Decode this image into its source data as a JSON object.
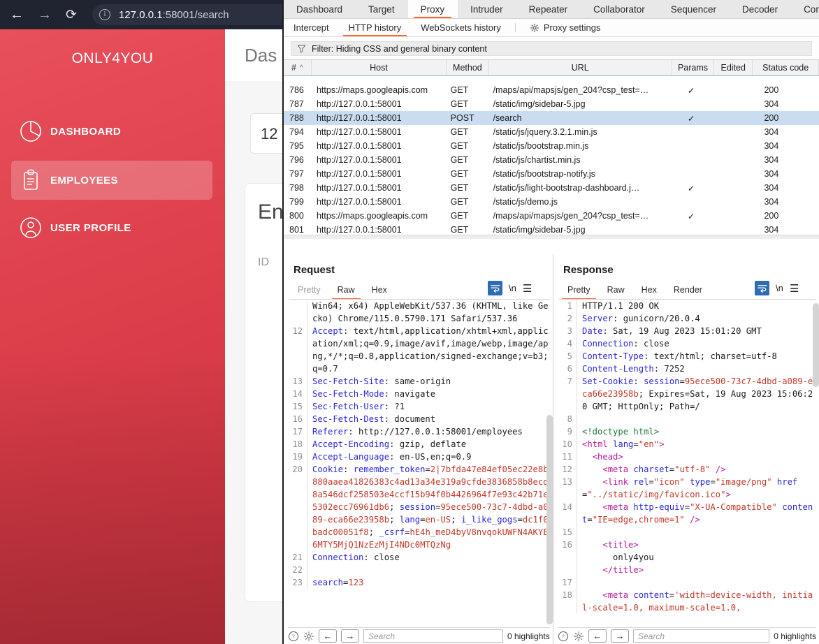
{
  "browser": {
    "url_host": "127.0.0.1",
    "url_rest": ":58001/search",
    "back_icon": "←",
    "forward_icon": "→",
    "reload_icon": "⟳",
    "info_icon": "i"
  },
  "webapp": {
    "brand": "ONLY4YOU",
    "nav": [
      {
        "label": "DASHBOARD",
        "icon": "pie-chart-icon"
      },
      {
        "label": "EMPLOYEES",
        "icon": "clipboard-icon"
      },
      {
        "label": "USER PROFILE",
        "icon": "user-circle-icon"
      }
    ],
    "page_title": "Das",
    "search_value": "12",
    "employees_card_title": "En",
    "employees_col_id": "ID"
  },
  "burp": {
    "main_tabs": [
      {
        "label": "Dashboard",
        "active": false
      },
      {
        "label": "Target",
        "active": false
      },
      {
        "label": "Proxy",
        "active": true
      },
      {
        "label": "Intruder",
        "active": false
      },
      {
        "label": "Repeater",
        "active": false
      },
      {
        "label": "Collaborator",
        "active": false
      },
      {
        "label": "Sequencer",
        "active": false
      },
      {
        "label": "Decoder",
        "active": false
      },
      {
        "label": "Comparer",
        "active": false
      }
    ],
    "sub_tabs": [
      {
        "label": "Intercept",
        "active": false
      },
      {
        "label": "HTTP history",
        "active": true
      },
      {
        "label": "WebSockets history",
        "active": false
      }
    ],
    "proxy_settings_label": "Proxy settings",
    "filter_text": "Filter: Hiding CSS and general binary content",
    "history": {
      "columns": [
        "#",
        "Host",
        "Method",
        "URL",
        "Params",
        "Edited",
        "Status code"
      ],
      "sort_indicator": "^",
      "rows": [
        {
          "num": "786",
          "host": "https://maps.googleapis.com",
          "method": "GET",
          "url": "/maps/api/mapsjs/gen_204?csp_test=…",
          "params": "✓",
          "edited": "",
          "status": "200",
          "selected": false
        },
        {
          "num": "787",
          "host": "http://127.0.0.1:58001",
          "method": "GET",
          "url": "/static/img/sidebar-5.jpg",
          "params": "",
          "edited": "",
          "status": "304",
          "selected": false
        },
        {
          "num": "788",
          "host": "http://127.0.0.1:58001",
          "method": "POST",
          "url": "/search",
          "params": "✓",
          "edited": "",
          "status": "200",
          "selected": true
        },
        {
          "num": "794",
          "host": "http://127.0.0.1:58001",
          "method": "GET",
          "url": "/static/js/jquery.3.2.1.min.js",
          "params": "",
          "edited": "",
          "status": "304",
          "selected": false
        },
        {
          "num": "795",
          "host": "http://127.0.0.1:58001",
          "method": "GET",
          "url": "/static/js/bootstrap.min.js",
          "params": "",
          "edited": "",
          "status": "304",
          "selected": false
        },
        {
          "num": "796",
          "host": "http://127.0.0.1:58001",
          "method": "GET",
          "url": "/static/js/chartist.min.js",
          "params": "",
          "edited": "",
          "status": "304",
          "selected": false
        },
        {
          "num": "797",
          "host": "http://127.0.0.1:58001",
          "method": "GET",
          "url": "/static/js/bootstrap-notify.js",
          "params": "",
          "edited": "",
          "status": "304",
          "selected": false
        },
        {
          "num": "798",
          "host": "http://127.0.0.1:58001",
          "method": "GET",
          "url": "/static/js/light-bootstrap-dashboard.j…",
          "params": "✓",
          "edited": "",
          "status": "304",
          "selected": false
        },
        {
          "num": "799",
          "host": "http://127.0.0.1:58001",
          "method": "GET",
          "url": "/static/js/demo.js",
          "params": "",
          "edited": "",
          "status": "304",
          "selected": false
        },
        {
          "num": "800",
          "host": "https://maps.googleapis.com",
          "method": "GET",
          "url": "/maps/api/mapsjs/gen_204?csp_test=…",
          "params": "✓",
          "edited": "",
          "status": "200",
          "selected": false
        },
        {
          "num": "801",
          "host": "http://127.0.0.1:58001",
          "method": "GET",
          "url": "/static/img/sidebar-5.jpg",
          "params": "",
          "edited": "",
          "status": "304",
          "selected": false
        }
      ]
    },
    "layout_buttons": [
      "side-by-side",
      "stacked",
      "single"
    ],
    "layout_selected": "side-by-side",
    "request": {
      "title": "Request",
      "tabs": [
        {
          "label": "Pretty",
          "active": false,
          "dim": true
        },
        {
          "label": "Raw",
          "active": true,
          "dim": false
        },
        {
          "label": "Hex",
          "active": false,
          "dim": false
        }
      ],
      "tool_newline": "\\n",
      "lines": [
        {
          "n": "",
          "parts": [
            {
              "t": "Win64; x64) AppleWebKit/537.36 (KHTML, like Gecko) Chrome/115.0.5790.171 Safari/537.36",
              "c": "plain"
            }
          ]
        },
        {
          "n": "12",
          "parts": [
            {
              "t": "Accept",
              "c": "hk"
            },
            {
              "t": ": ",
              "c": "plain"
            },
            {
              "t": "text/html,application/xhtml+xml,application/xml;q=0.9,image/avif,image/webp,image/apng,*/*;q=0.8,application/signed-exchange;v=b3;q=0.7",
              "c": "plain"
            }
          ]
        },
        {
          "n": "13",
          "parts": [
            {
              "t": "Sec-Fetch-Site",
              "c": "hk"
            },
            {
              "t": ": same-origin",
              "c": "plain"
            }
          ]
        },
        {
          "n": "14",
          "parts": [
            {
              "t": "Sec-Fetch-Mode",
              "c": "hk"
            },
            {
              "t": ": navigate",
              "c": "plain"
            }
          ]
        },
        {
          "n": "15",
          "parts": [
            {
              "t": "Sec-Fetch-User",
              "c": "hk"
            },
            {
              "t": ": ?1",
              "c": "plain"
            }
          ]
        },
        {
          "n": "16",
          "parts": [
            {
              "t": "Sec-Fetch-Dest",
              "c": "hk"
            },
            {
              "t": ": document",
              "c": "plain"
            }
          ]
        },
        {
          "n": "17",
          "parts": [
            {
              "t": "Referer",
              "c": "hk"
            },
            {
              "t": ": http://127.0.0.1:58001/employees",
              "c": "plain"
            }
          ]
        },
        {
          "n": "18",
          "parts": [
            {
              "t": "Accept-Encoding",
              "c": "hk"
            },
            {
              "t": ": gzip, deflate",
              "c": "plain"
            }
          ]
        },
        {
          "n": "19",
          "parts": [
            {
              "t": "Accept-Language",
              "c": "hk"
            },
            {
              "t": ": en-US,en;q=0.9",
              "c": "plain"
            }
          ]
        },
        {
          "n": "20",
          "parts": [
            {
              "t": "Cookie",
              "c": "hk"
            },
            {
              "t": ": ",
              "c": "plain"
            },
            {
              "t": "remember_token",
              "c": "hk"
            },
            {
              "t": "=",
              "c": "plain"
            },
            {
              "t": "2|7bfda47e84ef05ec22e8b880aaea41826383c4ad13a34e319a9cfde3836858b8ecd8a546dcf258503e4ccf15b94f0b4426964f7e93c42b71e5302ecc76961db6",
              "c": "red"
            },
            {
              "t": "; ",
              "c": "plain"
            },
            {
              "t": "session",
              "c": "hk"
            },
            {
              "t": "=",
              "c": "plain"
            },
            {
              "t": "95ece500-73c7-4dbd-a089-eca66e23958b",
              "c": "red"
            },
            {
              "t": "; ",
              "c": "plain"
            },
            {
              "t": "lang",
              "c": "hk"
            },
            {
              "t": "=",
              "c": "plain"
            },
            {
              "t": "en-US",
              "c": "red"
            },
            {
              "t": "; ",
              "c": "plain"
            },
            {
              "t": "i_like_gogs",
              "c": "hk"
            },
            {
              "t": "=",
              "c": "plain"
            },
            {
              "t": "dc1f0badc00051f8",
              "c": "red"
            },
            {
              "t": "; ",
              "c": "plain"
            },
            {
              "t": "_csrf",
              "c": "hk"
            },
            {
              "t": "=",
              "c": "plain"
            },
            {
              "t": "hE4h_meD4byV8nvqokUWFN4AKYE6MTY5MjQ1NzEzMjI4NDc0MTQzNg",
              "c": "red"
            }
          ]
        },
        {
          "n": "21",
          "parts": [
            {
              "t": "Connection",
              "c": "hk"
            },
            {
              "t": ": close",
              "c": "plain"
            }
          ]
        },
        {
          "n": "22",
          "parts": [
            {
              "t": "",
              "c": "plain"
            }
          ]
        },
        {
          "n": "23",
          "parts": [
            {
              "t": "search",
              "c": "hk"
            },
            {
              "t": "=",
              "c": "plain"
            },
            {
              "t": "123",
              "c": "red"
            }
          ]
        }
      ],
      "footer": {
        "help_icon": "?",
        "gear_icon": "gear-icon",
        "back_icon": "←",
        "forward_icon": "→",
        "search_placeholder": "Search",
        "highlights": "0 highlights"
      }
    },
    "response": {
      "title": "Response",
      "tabs": [
        {
          "label": "Pretty",
          "active": true,
          "dim": false
        },
        {
          "label": "Raw",
          "active": false,
          "dim": false
        },
        {
          "label": "Hex",
          "active": false,
          "dim": false
        },
        {
          "label": "Render",
          "active": false,
          "dim": false
        }
      ],
      "tool_newline": "\\n",
      "lines": [
        {
          "n": "1",
          "parts": [
            {
              "t": "HTTP/1.1 200 OK",
              "c": "plain"
            }
          ]
        },
        {
          "n": "2",
          "parts": [
            {
              "t": "Server",
              "c": "hk"
            },
            {
              "t": ": gunicorn/20.0.4",
              "c": "plain"
            }
          ]
        },
        {
          "n": "3",
          "parts": [
            {
              "t": "Date",
              "c": "hk"
            },
            {
              "t": ": Sat, 19 Aug 2023 15:01:20 GMT",
              "c": "plain"
            }
          ]
        },
        {
          "n": "4",
          "parts": [
            {
              "t": "Connection",
              "c": "hk"
            },
            {
              "t": ": close",
              "c": "plain"
            }
          ]
        },
        {
          "n": "5",
          "parts": [
            {
              "t": "Content-Type",
              "c": "hk"
            },
            {
              "t": ": text/html; charset=utf-8",
              "c": "plain"
            }
          ]
        },
        {
          "n": "6",
          "parts": [
            {
              "t": "Content-Length",
              "c": "hk"
            },
            {
              "t": ": 7252",
              "c": "plain"
            }
          ]
        },
        {
          "n": "7",
          "parts": [
            {
              "t": "Set-Cookie",
              "c": "hk"
            },
            {
              "t": ": ",
              "c": "plain"
            },
            {
              "t": "session",
              "c": "hk"
            },
            {
              "t": "=",
              "c": "plain"
            },
            {
              "t": "95ece500-73c7-4dbd-a089-eca66e23958b",
              "c": "red"
            },
            {
              "t": "; Expires=Sat, 19 Aug 2023 15:06:20 GMT; HttpOnly; Path=/",
              "c": "plain"
            }
          ]
        },
        {
          "n": "8",
          "parts": [
            {
              "t": "",
              "c": "plain"
            }
          ]
        },
        {
          "n": "9",
          "parts": [
            {
              "t": "<!doctype html>",
              "c": "doct"
            }
          ]
        },
        {
          "n": "10",
          "parts": [
            {
              "t": "<html ",
              "c": "tag"
            },
            {
              "t": "lang",
              "c": "attr"
            },
            {
              "t": "=",
              "c": "plain"
            },
            {
              "t": "\"en\"",
              "c": "str"
            },
            {
              "t": ">",
              "c": "tag"
            }
          ]
        },
        {
          "n": "11",
          "parts": [
            {
              "t": "  ",
              "c": "plain"
            },
            {
              "t": "<head>",
              "c": "tag"
            }
          ]
        },
        {
          "n": "12",
          "parts": [
            {
              "t": "    ",
              "c": "plain"
            },
            {
              "t": "<meta ",
              "c": "tag"
            },
            {
              "t": "charset",
              "c": "attr"
            },
            {
              "t": "=",
              "c": "plain"
            },
            {
              "t": "\"utf-8\"",
              "c": "str"
            },
            {
              "t": " />",
              "c": "tag"
            }
          ]
        },
        {
          "n": "13",
          "parts": [
            {
              "t": "    ",
              "c": "plain"
            },
            {
              "t": "<link ",
              "c": "tag"
            },
            {
              "t": "rel",
              "c": "attr"
            },
            {
              "t": "=",
              "c": "plain"
            },
            {
              "t": "\"icon\"",
              "c": "str"
            },
            {
              "t": " ",
              "c": "plain"
            },
            {
              "t": "type",
              "c": "attr"
            },
            {
              "t": "=",
              "c": "plain"
            },
            {
              "t": "\"image/png\"",
              "c": "str"
            },
            {
              "t": " ",
              "c": "plain"
            },
            {
              "t": "href",
              "c": "attr"
            },
            {
              "t": "=",
              "c": "plain"
            },
            {
              "t": "\"../static/img/favicon.ico\"",
              "c": "str"
            },
            {
              "t": ">",
              "c": "tag"
            }
          ]
        },
        {
          "n": "14",
          "parts": [
            {
              "t": "    ",
              "c": "plain"
            },
            {
              "t": "<meta ",
              "c": "tag"
            },
            {
              "t": "http-equiv",
              "c": "attr"
            },
            {
              "t": "=",
              "c": "plain"
            },
            {
              "t": "\"X-UA-Compatible\"",
              "c": "str"
            },
            {
              "t": " ",
              "c": "plain"
            },
            {
              "t": "content",
              "c": "attr"
            },
            {
              "t": "=",
              "c": "plain"
            },
            {
              "t": "\"IE=edge,chrome=1\"",
              "c": "str"
            },
            {
              "t": " />",
              "c": "tag"
            }
          ]
        },
        {
          "n": "15",
          "parts": [
            {
              "t": "",
              "c": "plain"
            }
          ]
        },
        {
          "n": "16",
          "parts": [
            {
              "t": "    ",
              "c": "plain"
            },
            {
              "t": "<title>",
              "c": "tag"
            },
            {
              "t": "\n      only4you\n    ",
              "c": "plain"
            },
            {
              "t": "</title>",
              "c": "tag"
            }
          ]
        },
        {
          "n": "17",
          "parts": [
            {
              "t": "",
              "c": "plain"
            }
          ]
        },
        {
          "n": "18",
          "parts": [
            {
              "t": "    ",
              "c": "plain"
            },
            {
              "t": "<meta ",
              "c": "tag"
            },
            {
              "t": "content",
              "c": "attr"
            },
            {
              "t": "=",
              "c": "plain"
            },
            {
              "t": "'width=device-width, initial-scale=1.0, maximum-scale=1.0,",
              "c": "str"
            }
          ]
        }
      ],
      "footer": {
        "help_icon": "?",
        "gear_icon": "gear-icon",
        "back_icon": "←",
        "forward_icon": "→",
        "search_placeholder": "Search",
        "highlights": "0 highlights"
      }
    }
  },
  "colors": {
    "accent_orange": "#ff6633",
    "selection_blue": "#c9dcf0",
    "brand_red": "#e8505b",
    "tool_blue": "#2e6db4"
  }
}
